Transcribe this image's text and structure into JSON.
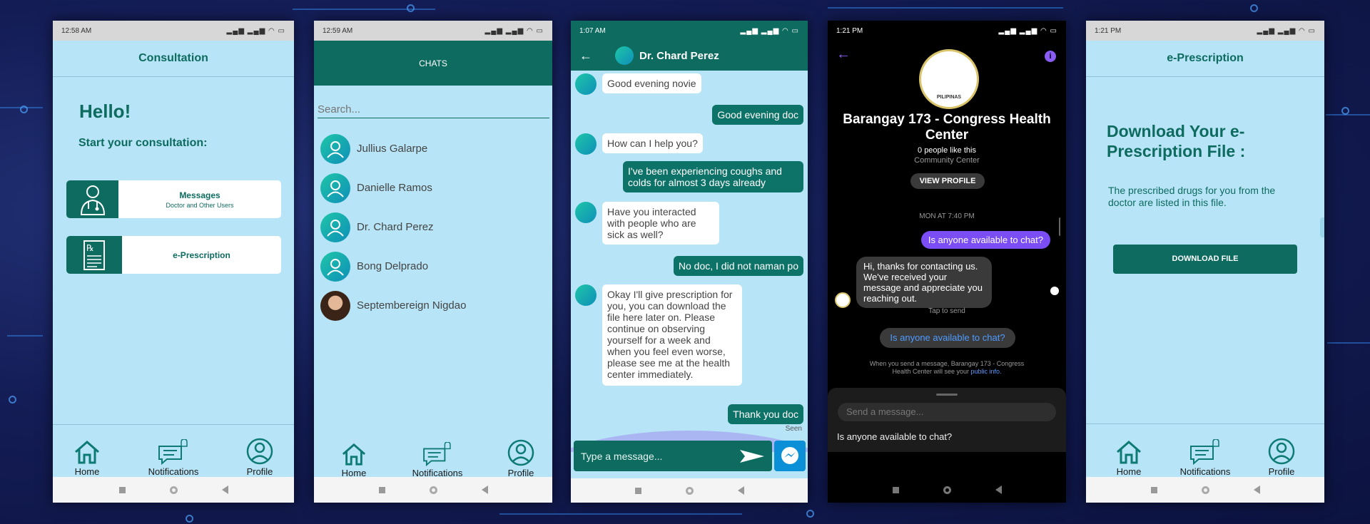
{
  "screens": {
    "consultation": {
      "status_time": "12:58 AM",
      "title": "Consultation",
      "greeting": "Hello!",
      "prompt": "Start your consultation:",
      "messages_label": "Messages",
      "messages_sub": "Doctor and Other Users",
      "eprescription_label": "e-Prescription"
    },
    "chats": {
      "status_time": "12:59 AM",
      "title": "CHATS",
      "search_placeholder": "Search...",
      "contacts": [
        "Jullius Galarpe",
        "Danielle Ramos",
        "Dr. Chard Perez",
        "Bong Delprado",
        "Septembereign Nigdao"
      ]
    },
    "conversation": {
      "status_time": "1:07 AM",
      "contact_name": "Dr. Chard Perez",
      "messages": [
        {
          "dir": "in",
          "text": "Good evening novie"
        },
        {
          "dir": "out",
          "text": "Good evening doc"
        },
        {
          "dir": "in",
          "text": "How can I help you?"
        },
        {
          "dir": "out",
          "text": "I've been experiencing coughs and colds for almost 3 days already"
        },
        {
          "dir": "in",
          "text": "Have you interacted with people who are sick as well?"
        },
        {
          "dir": "out",
          "text": "No doc, I did not naman po"
        },
        {
          "dir": "in",
          "text": "Okay I'll give prescription for you, you can download the file here later on. Please continue on observing yourself for a week and when you feel even worse, please see me at the health center immediately."
        },
        {
          "dir": "out",
          "text": "Thank you doc"
        }
      ],
      "seen_label": "Seen",
      "input_placeholder": "Type a message..."
    },
    "messenger": {
      "status_time": "1:21 PM",
      "page_name": "Barangay 173 - Congress Health Center",
      "likes": "0 people like this",
      "category": "Community Center",
      "view_profile": "VIEW PROFILE",
      "date_label": "MON AT 7:40 PM",
      "sent_message": "Is anyone available to chat?",
      "reply": "Hi, thanks for contacting us. We've received your message and appreciate you reaching out.",
      "tap_to_send": "Tap to send",
      "suggestion": "Is anyone available to chat?",
      "notice": "When you send a message, Barangay 173 - Congress Health Center will see your",
      "notice_link": "public info.",
      "input_placeholder": "Send a message...",
      "quick_reply": "Is anyone available to chat?",
      "seal_text": "PILIPINAS"
    },
    "eprescription": {
      "status_time": "1:21 PM",
      "title": "e-Prescription",
      "heading": "Download Your e-Prescription File :",
      "description": "The prescribed drugs for you from the doctor are listed in this file.",
      "download_button": "DOWNLOAD FILE"
    }
  },
  "bottom_nav": {
    "home": "Home",
    "notifications": "Notifications",
    "profile": "Profile"
  },
  "colors": {
    "teal": "#0d6b5f",
    "light_blue": "#b7e4f6",
    "messenger_purple": "#7b4df5",
    "dark_bg": "#000000"
  }
}
